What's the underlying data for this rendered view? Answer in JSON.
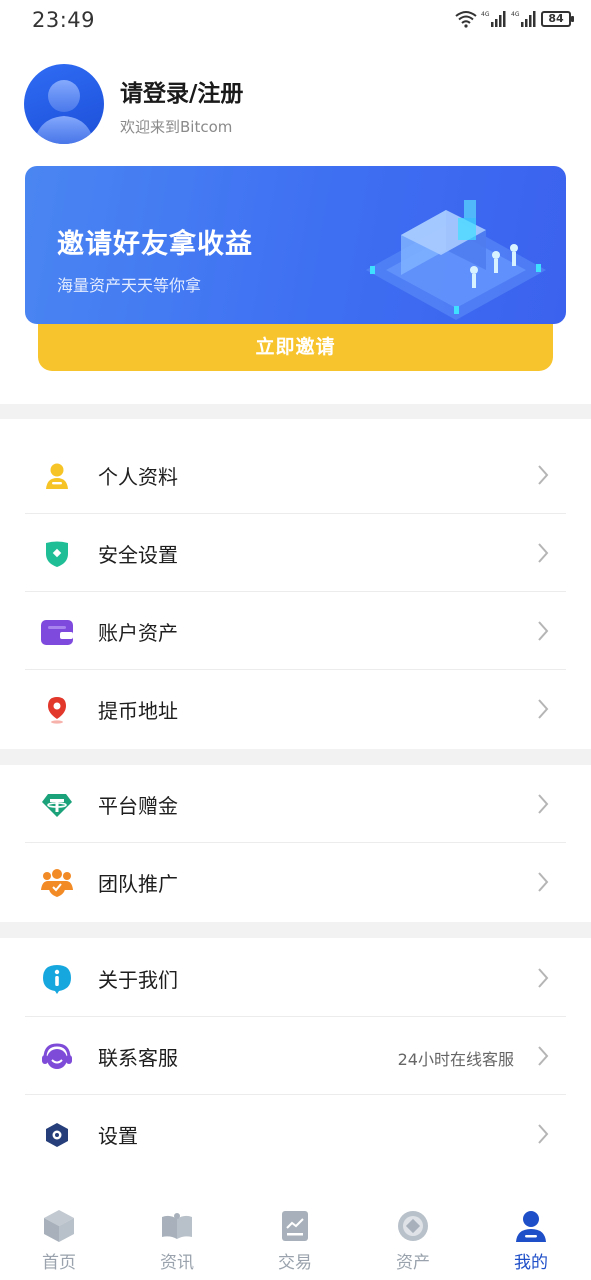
{
  "status_bar": {
    "time": "23:49",
    "battery": "84"
  },
  "profile": {
    "title": "请登录/注册",
    "subtitle": "欢迎来到Bitcom"
  },
  "banner": {
    "title": "邀请好友拿收益",
    "subtitle": "海量资产天天等你拿",
    "button": "立即邀请"
  },
  "menu": [
    {
      "label": "个人资料",
      "icon": "person-icon",
      "color": "#f7c428"
    },
    {
      "label": "安全设置",
      "icon": "shield-icon",
      "color": "#1fbe97"
    },
    {
      "label": "账户资产",
      "icon": "wallet-icon",
      "color": "#7e49dd"
    },
    {
      "label": "提币地址",
      "icon": "location-pin-icon",
      "color": "#e2382c"
    },
    {
      "label": "平台赠金",
      "icon": "tether-icon",
      "color": "#1ba27a"
    },
    {
      "label": "团队推广",
      "icon": "team-icon",
      "color": "#f28a25"
    },
    {
      "label": "关于我们",
      "icon": "info-icon",
      "color": "#17a7df"
    },
    {
      "label": "联系客服",
      "icon": "headset-icon",
      "color": "#7e4ad8",
      "hint": "24小时在线客服"
    },
    {
      "label": "设置",
      "icon": "gear-icon",
      "color": "#263f7a"
    }
  ],
  "tabs": [
    {
      "label": "首页",
      "icon": "cube-icon"
    },
    {
      "label": "资讯",
      "icon": "book-icon"
    },
    {
      "label": "交易",
      "icon": "chart-icon"
    },
    {
      "label": "资产",
      "icon": "coin-icon"
    },
    {
      "label": "我的",
      "icon": "user-icon",
      "active": true
    }
  ],
  "colors": {
    "brand_blue": "#3e6ff2",
    "invite_yellow": "#f8c42d",
    "active_tab": "#1f4fc8",
    "inactive_tab": "#9aa3ad"
  }
}
